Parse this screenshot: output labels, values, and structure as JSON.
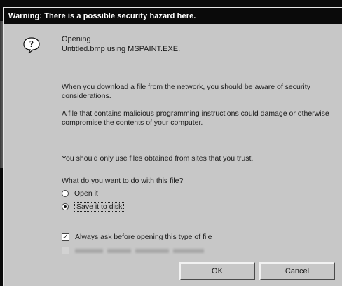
{
  "window": {
    "title": "Warning:  There is a possible security hazard here."
  },
  "opening": {
    "label": "Opening",
    "file_text": "Untitled.bmp using MSPAINT.EXE."
  },
  "message": {
    "paragraph_1": "When you download a file from the network, you should be aware of security considerations.",
    "paragraph_2": "A file that contains malicious programming instructions could damage or otherwise compromise the contents of your computer.",
    "paragraph_3": "You should only use files obtained from sites that you trust."
  },
  "question": "What do you want to do with this file?",
  "options": {
    "open_it": "Open it",
    "save_it": "Save it to disk",
    "selected": "save_it"
  },
  "checkboxes": {
    "always_ask": {
      "label": "Always ask before opening this type of file",
      "checked": true
    },
    "disabled_option": {
      "checked": false,
      "enabled": false
    }
  },
  "buttons": {
    "ok": "OK",
    "cancel": "Cancel"
  },
  "icons": {
    "warning": "question-icon"
  },
  "colors": {
    "title_bar": "#0a0a0a",
    "dialog_bg": "#c7c7c7"
  }
}
